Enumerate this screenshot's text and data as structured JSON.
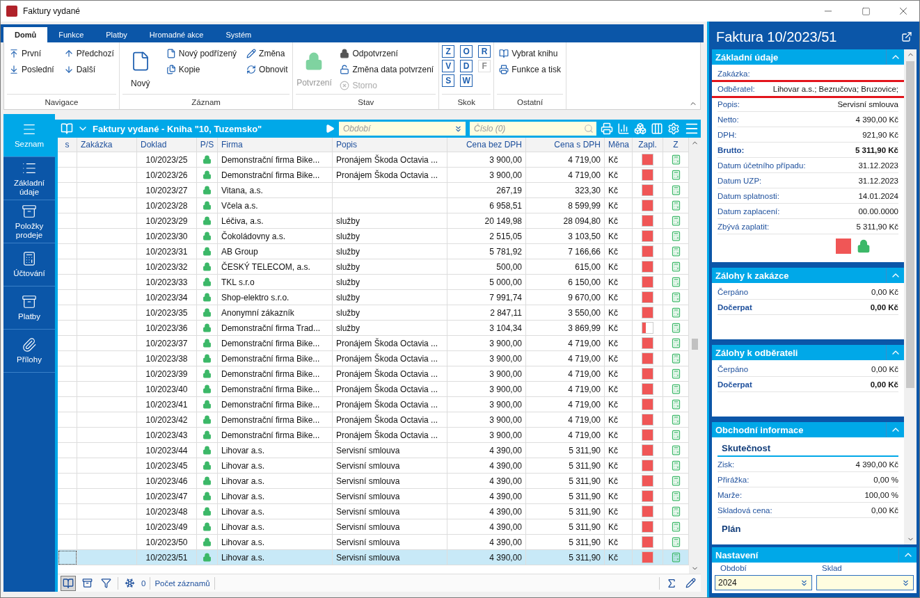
{
  "window": {
    "title": "Faktury vydané"
  },
  "ribbon": {
    "tabs": [
      {
        "label": "Domů",
        "selected": true
      },
      {
        "label": "Funkce",
        "selected": false
      },
      {
        "label": "Platby",
        "selected": false
      },
      {
        "label": "Hromadné akce",
        "selected": false
      },
      {
        "label": "Systém",
        "selected": false
      }
    ],
    "groups": [
      {
        "label": "Navigace",
        "columns": [
          [
            {
              "label": "První",
              "kind": "small",
              "disabled": false
            },
            {
              "label": "Poslední",
              "kind": "small",
              "disabled": false
            }
          ],
          [
            {
              "label": "Předchozí",
              "kind": "small",
              "disabled": false
            },
            {
              "label": "Další",
              "kind": "small",
              "disabled": false
            }
          ]
        ]
      },
      {
        "label": "Záznam",
        "columns": [
          [
            {
              "label": "Nový",
              "kind": "large",
              "disabled": false
            }
          ],
          [
            {
              "label": "Nový podřízený",
              "kind": "small",
              "disabled": false
            },
            {
              "label": "Kopie",
              "kind": "small",
              "disabled": false
            }
          ],
          [
            {
              "label": "Změna",
              "kind": "small",
              "disabled": false
            },
            {
              "label": "Obnovit",
              "kind": "small",
              "disabled": false
            }
          ]
        ]
      },
      {
        "label": "Stav",
        "columns": [
          [
            {
              "label": "Potvrzení",
              "kind": "large",
              "disabled": true
            }
          ],
          [
            {
              "label": "Odpotvrzení",
              "kind": "small",
              "disabled": false
            },
            {
              "label": "Změna data potvrzení",
              "kind": "small",
              "disabled": false
            },
            {
              "label": "Storno",
              "kind": "small",
              "disabled": true
            }
          ]
        ]
      },
      {
        "label": "Skok",
        "columns": [
          [
            {
              "label": "Z",
              "kind": "letter",
              "disabled": false
            },
            {
              "label": "V",
              "kind": "letter",
              "disabled": false
            },
            {
              "label": "S",
              "kind": "letter",
              "disabled": false
            }
          ],
          [
            {
              "label": "O",
              "kind": "letter",
              "disabled": false
            },
            {
              "label": "D",
              "kind": "letter",
              "disabled": false
            },
            {
              "label": "W",
              "kind": "letter",
              "disabled": false
            }
          ],
          [
            {
              "label": "R",
              "kind": "letter",
              "disabled": false
            },
            {
              "label": "F",
              "kind": "letter",
              "disabled": true
            }
          ]
        ]
      },
      {
        "label": "Ostatní",
        "columns": [
          [
            {
              "label": "Vybrat knihu",
              "kind": "small",
              "disabled": false
            },
            {
              "label": "Funkce a tisk",
              "kind": "small",
              "disabled": false
            }
          ]
        ]
      }
    ]
  },
  "sidebar": {
    "items": [
      {
        "label": "Seznam",
        "selected": true
      },
      {
        "label": "Základní údaje",
        "selected": false
      },
      {
        "label": "Položky prodeje",
        "selected": false
      },
      {
        "label": "Účtování",
        "selected": false
      },
      {
        "label": "Platby",
        "selected": false
      },
      {
        "label": "Přílohy",
        "selected": false
      }
    ]
  },
  "grid": {
    "title": "Faktury vydané - Kniha \"10, Tuzemsko\"",
    "period_placeholder": "Období",
    "number_placeholder": "Číslo (0)",
    "columns": [
      "s",
      "Zakázka",
      "Doklad",
      "P/S",
      "Firma",
      "Popis",
      "Cena bez DPH",
      "Cena s DPH",
      "Měna",
      "Zapl.",
      "Z"
    ],
    "rows": [
      {
        "doklad": "10/2023/25",
        "firma": "Demonstrační firma Bike...",
        "popis": "Pronájem Škoda Octavia ...",
        "bez": "3 900,00",
        "s": "4 719,00",
        "mena": "Kč",
        "level": 1,
        "selected": false
      },
      {
        "doklad": "10/2023/26",
        "firma": "Demonstrační firma Bike...",
        "popis": "Pronájem Škoda Octavia ...",
        "bez": "3 900,00",
        "s": "4 719,00",
        "mena": "Kč",
        "level": 1,
        "selected": false
      },
      {
        "doklad": "10/2023/27",
        "firma": "Vitana, a.s.",
        "bez": "267,19",
        "s": "323,30",
        "mena": "Kč",
        "level": 1,
        "selected": false
      },
      {
        "doklad": "10/2023/28",
        "firma": "Včela a.s.",
        "bez": "6 958,51",
        "s": "8 599,99",
        "mena": "Kč",
        "level": 1,
        "selected": false
      },
      {
        "doklad": "10/2023/29",
        "firma": "Léčiva, a.s.",
        "popis": "služby",
        "bez": "20 149,98",
        "s": "28 094,80",
        "mena": "Kč",
        "level": 1,
        "selected": false
      },
      {
        "doklad": "10/2023/30",
        "firma": "Čokoládovny a.s.",
        "popis": "služby",
        "bez": "2 515,05",
        "s": "3 103,50",
        "mena": "Kč",
        "level": 1,
        "selected": false
      },
      {
        "doklad": "10/2023/31",
        "firma": "AB Group",
        "popis": "služby",
        "bez": "5 781,92",
        "s": "7 166,66",
        "mena": "Kč",
        "level": 1,
        "selected": false
      },
      {
        "doklad": "10/2023/32",
        "firma": "ČESKÝ TELECOM, a.s.",
        "popis": "služby",
        "bez": "500,00",
        "s": "615,00",
        "mena": "Kč",
        "level": 1,
        "selected": false
      },
      {
        "doklad": "10/2023/33",
        "firma": "TKL s.r.o",
        "popis": "služby",
        "bez": "5 000,00",
        "s": "6 150,00",
        "mena": "Kč",
        "level": 1,
        "selected": false
      },
      {
        "doklad": "10/2023/34",
        "firma": "Shop-elektro s.r.o.",
        "popis": "služby",
        "bez": "7 991,74",
        "s": "9 670,00",
        "mena": "Kč",
        "level": 1,
        "selected": false
      },
      {
        "doklad": "10/2023/35",
        "firma": "Anonymní zákazník",
        "popis": "služby",
        "bez": "2 847,11",
        "s": "3 550,00",
        "mena": "Kč",
        "level": 1,
        "selected": false
      },
      {
        "doklad": "10/2023/36",
        "firma": "Demonstrační firma Trad...",
        "popis": "služby",
        "bez": "3 104,34",
        "s": "3 869,99",
        "mena": "Kč",
        "level": 0.35,
        "selected": false
      },
      {
        "doklad": "10/2023/37",
        "firma": "Demonstrační firma Bike...",
        "popis": "Pronájem Škoda Octavia ...",
        "bez": "3 900,00",
        "s": "4 719,00",
        "mena": "Kč",
        "level": 1,
        "selected": false
      },
      {
        "doklad": "10/2023/38",
        "firma": "Demonstrační firma Bike...",
        "popis": "Pronájem Škoda Octavia ...",
        "bez": "3 900,00",
        "s": "4 719,00",
        "mena": "Kč",
        "level": 1,
        "selected": false
      },
      {
        "doklad": "10/2023/39",
        "firma": "Demonstrační firma Bike...",
        "popis": "Pronájem Škoda Octavia ...",
        "bez": "3 900,00",
        "s": "4 719,00",
        "mena": "Kč",
        "level": 1,
        "selected": false
      },
      {
        "doklad": "10/2023/40",
        "firma": "Demonstrační firma Bike...",
        "popis": "Pronájem Škoda Octavia ...",
        "bez": "3 900,00",
        "s": "4 719,00",
        "mena": "Kč",
        "level": 1,
        "selected": false
      },
      {
        "doklad": "10/2023/41",
        "firma": "Demonstrační firma Bike...",
        "popis": "Pronájem Škoda Octavia ...",
        "bez": "3 900,00",
        "s": "4 719,00",
        "mena": "Kč",
        "level": 1,
        "selected": false
      },
      {
        "doklad": "10/2023/42",
        "firma": "Demonstrační firma Bike...",
        "popis": "Pronájem Škoda Octavia ...",
        "bez": "3 900,00",
        "s": "4 719,00",
        "mena": "Kč",
        "level": 1,
        "selected": false
      },
      {
        "doklad": "10/2023/43",
        "firma": "Demonstrační firma Bike...",
        "popis": "Pronájem Škoda Octavia ...",
        "bez": "3 900,00",
        "s": "4 719,00",
        "mena": "Kč",
        "level": 1,
        "selected": false
      },
      {
        "doklad": "10/2023/44",
        "firma": "Lihovar a.s.",
        "popis": "Servisní smlouva",
        "bez": "4 390,00",
        "s": "5 311,90",
        "mena": "Kč",
        "level": 1,
        "selected": false
      },
      {
        "doklad": "10/2023/45",
        "firma": "Lihovar a.s.",
        "popis": "Servisní smlouva",
        "bez": "4 390,00",
        "s": "5 311,90",
        "mena": "Kč",
        "level": 1,
        "selected": false
      },
      {
        "doklad": "10/2023/46",
        "firma": "Lihovar a.s.",
        "popis": "Servisní smlouva",
        "bez": "4 390,00",
        "s": "5 311,90",
        "mena": "Kč",
        "level": 1,
        "selected": false
      },
      {
        "doklad": "10/2023/47",
        "firma": "Lihovar a.s.",
        "popis": "Servisní smlouva",
        "bez": "4 390,00",
        "s": "5 311,90",
        "mena": "Kč",
        "level": 1,
        "selected": false
      },
      {
        "doklad": "10/2023/48",
        "firma": "Lihovar a.s.",
        "popis": "Servisní smlouva",
        "bez": "4 390,00",
        "s": "5 311,90",
        "mena": "Kč",
        "level": 1,
        "selected": false
      },
      {
        "doklad": "10/2023/49",
        "firma": "Lihovar a.s.",
        "popis": "Servisní smlouva",
        "bez": "4 390,00",
        "s": "5 311,90",
        "mena": "Kč",
        "level": 1,
        "selected": false
      },
      {
        "doklad": "10/2023/50",
        "firma": "Lihovar a.s.",
        "popis": "Servisní smlouva",
        "bez": "4 390,00",
        "s": "5 311,90",
        "mena": "Kč",
        "level": 1,
        "selected": false
      },
      {
        "doklad": "10/2023/51",
        "firma": "Lihovar a.s.",
        "popis": "Servisní smlouva",
        "bez": "4 390,00",
        "s": "5 311,90",
        "mena": "Kč",
        "level": 1,
        "selected": true
      }
    ],
    "status_bar": {
      "count": "0",
      "label": "Počet záznamů"
    }
  },
  "detail": {
    "title": "Faktura 10/2023/51",
    "sections": [
      {
        "title": "Základní údaje",
        "items": [
          {
            "kind": "field",
            "label": "Zakázka:",
            "highlighted": false
          },
          {
            "kind": "field",
            "label": "Odběratel:",
            "value": "Lihovar a.s.; Bezručova; Bruzovice;",
            "highlighted": true
          },
          {
            "kind": "field",
            "label": "Popis:",
            "value": "Servisní smlouva",
            "highlighted": false
          },
          {
            "kind": "field",
            "label": "Netto:",
            "value": "4 390,00 Kč",
            "highlighted": false
          },
          {
            "kind": "field",
            "label": "DPH:",
            "value": "921,90 Kč",
            "highlighted": false
          },
          {
            "kind": "total",
            "label": "Brutto:",
            "value": "5 311,90 Kč",
            "highlighted": false
          },
          {
            "kind": "field",
            "label": "Datum účetního případu:",
            "value": "31.12.2023",
            "highlighted": false
          },
          {
            "kind": "field",
            "label": "Datum UZP:",
            "value": "31.12.2023",
            "highlighted": false
          },
          {
            "kind": "field",
            "label": "Datum splatnosti:",
            "value": "14.01.2024",
            "highlighted": false
          },
          {
            "kind": "field",
            "label": "Datum zaplacení:",
            "value": "00.00.0000",
            "highlighted": false
          },
          {
            "kind": "field",
            "label": "Zbývá zaplatit:",
            "value": "5 311,90 Kč",
            "highlighted": false
          },
          {
            "kind": "status",
            "level": 1
          }
        ]
      },
      {
        "title": "Zálohy k zakázce",
        "items": [
          {
            "kind": "line",
            "label": "Čerpáno",
            "value": "0,00 Kč"
          },
          {
            "kind": "total",
            "label": "Dočerpat",
            "value": "0,00 Kč"
          }
        ]
      },
      {
        "title": "Zálohy k odběrateli",
        "items": [
          {
            "kind": "line",
            "label": "Čerpáno",
            "value": "0,00 Kč"
          },
          {
            "kind": "total",
            "label": "Dočerpat",
            "value": "0,00 Kč"
          }
        ]
      },
      {
        "title": "Obchodní informace",
        "items": [
          {
            "kind": "subheading",
            "label": "Skutečnost"
          },
          {
            "kind": "line",
            "label": "Zisk:",
            "value": "4 390,00 Kč"
          },
          {
            "kind": "line",
            "label": "Přirážka:",
            "value": "0,00 %"
          },
          {
            "kind": "line",
            "label": "Marže:",
            "value": "100,00 %"
          },
          {
            "kind": "line",
            "label": "Skladová cena:",
            "value": "0,00 Kč"
          },
          {
            "kind": "subheading",
            "label": "Plán"
          }
        ]
      }
    ],
    "settings": {
      "title": "Nastavení",
      "fields": [
        {
          "label": "Období",
          "value": "2024"
        },
        {
          "label": "Sklad"
        }
      ]
    }
  }
}
